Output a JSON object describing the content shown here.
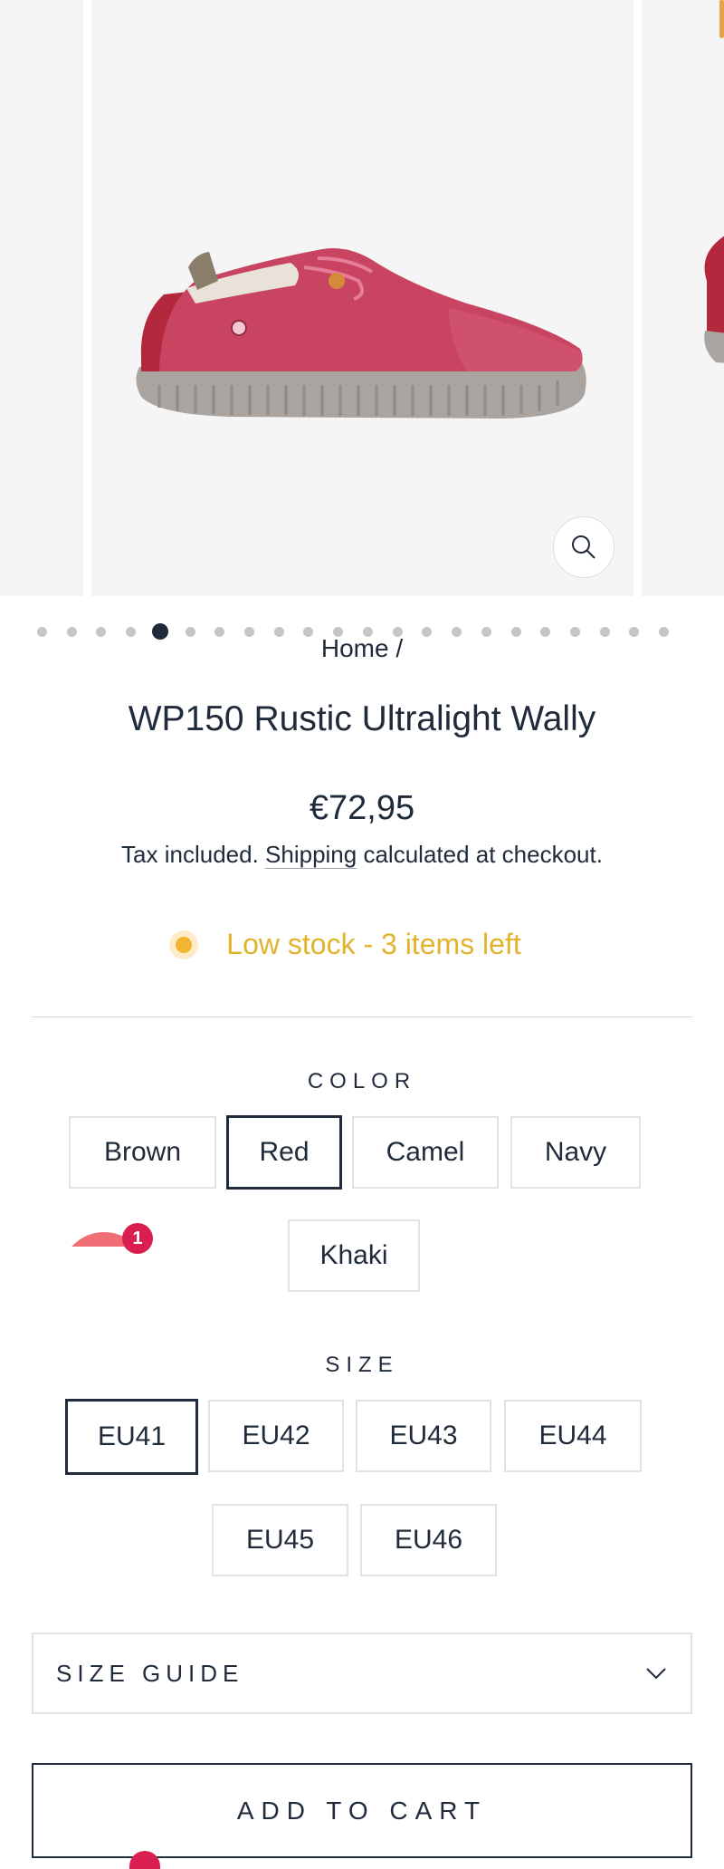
{
  "gallery": {
    "dots_total": 22,
    "active_dot_index": 4
  },
  "breadcrumb": {
    "home": "Home",
    "separator": "/"
  },
  "product": {
    "title": "WP150 Rustic Ultralight Wally",
    "price": "€72,95",
    "tax_prefix": "Tax included.",
    "shipping_link": "Shipping",
    "tax_suffix": "calculated at checkout.",
    "stock_status": "Low stock - 3 items left",
    "stock_color": "#e0b42c"
  },
  "color_option": {
    "label": "COLOR",
    "values": [
      "Brown",
      "Red",
      "Camel",
      "Navy",
      "Khaki"
    ],
    "selected": "Red"
  },
  "size_option": {
    "label": "SIZE",
    "values": [
      "EU41",
      "EU42",
      "EU43",
      "EU44",
      "EU45",
      "EU46"
    ],
    "selected": "EU41"
  },
  "size_guide": {
    "label": "SIZE GUIDE",
    "icon": "chevron-down-icon"
  },
  "add_to_cart": {
    "label": "ADD TO CART"
  },
  "notification": {
    "count": "1",
    "color": "#d81f4f"
  },
  "colors": {
    "text": "#1f2a3a",
    "border": "#e2e2e2",
    "accent": "#f2b531"
  }
}
